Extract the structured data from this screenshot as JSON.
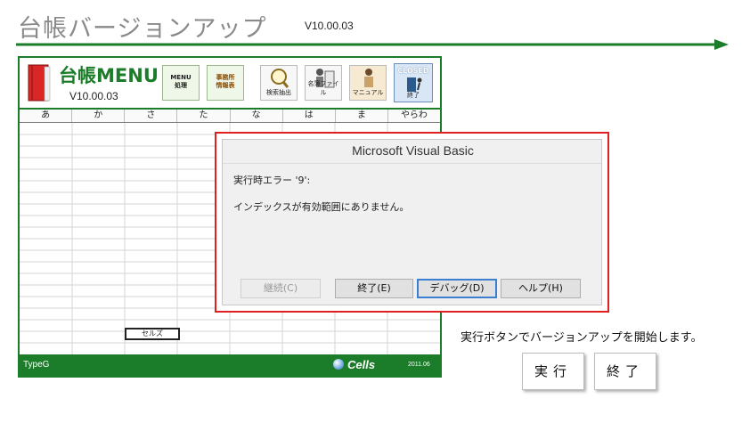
{
  "header": {
    "title": "台帳バージョンアップ",
    "version": "V10.00.03"
  },
  "ledger": {
    "menu_title": "台帳MENU",
    "menu_version": "V10.00.03",
    "toolbar": {
      "menu_label": "MENU\n処理",
      "office_label": "事務所\n情報表",
      "search_label": "検索抽出",
      "file_label": "名簿ファイル",
      "manual_label": "マニュアル",
      "closed_label": "CLOSED",
      "closed_sub": "終了"
    },
    "kana_tabs": [
      "あ",
      "か",
      "さ",
      "た",
      "な",
      "は",
      "ま",
      "やらわ"
    ],
    "selected_cell_text": "セルズ",
    "footer": {
      "type_label": "TypeG",
      "brand": "Cells",
      "date": "2011.06"
    }
  },
  "dialog": {
    "title": "Microsoft Visual Basic",
    "error_code": "実行時エラー '9':",
    "error_message": "インデックスが有効範囲にありません。",
    "buttons": {
      "continue": "継続(C)",
      "end": "終了(E)",
      "debug": "デバッグ(D)",
      "help": "ヘルプ(H)"
    }
  },
  "instructions": {
    "text": "実行ボタンでバージョンアップを開始します。",
    "run_label": "実行",
    "exit_label": "終了"
  },
  "colors": {
    "accent_green": "#1b7d2a",
    "dialog_border": "#e02020",
    "focus_blue": "#3c7fd1"
  }
}
